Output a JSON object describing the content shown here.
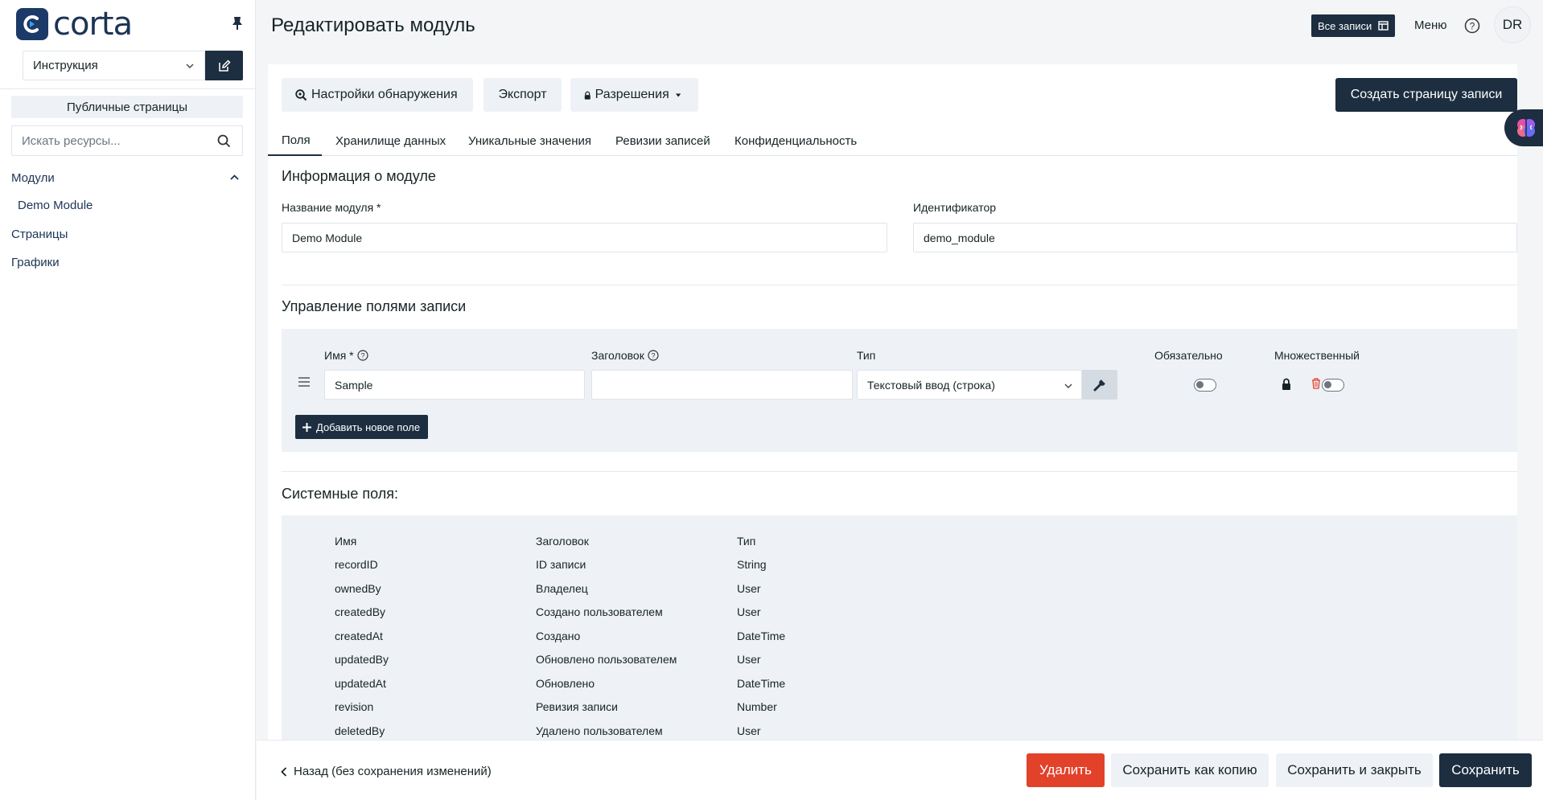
{
  "brand": {
    "name": "corta"
  },
  "sidebar": {
    "namespace": "Инструкция",
    "public_pages": "Публичные страницы",
    "search_placeholder": "Искать ресурсы...",
    "modules_heading": "Модули",
    "module_items": [
      "Demo Module"
    ],
    "pages": "Страницы",
    "charts": "Графики"
  },
  "header": {
    "title": "Редактировать модуль",
    "all_records": "Все записи",
    "menu": "Меню",
    "avatar_initials": "DR"
  },
  "toolbar": {
    "discovery": "Настройки обнаружения",
    "export": "Экспорт",
    "permissions": "Разрешения",
    "create_record_page": "Создать страницу записи"
  },
  "tabs": [
    {
      "label": "Поля",
      "active": true
    },
    {
      "label": "Хранилище данных",
      "active": false
    },
    {
      "label": "Уникальные значения",
      "active": false
    },
    {
      "label": "Ревизии записей",
      "active": false
    },
    {
      "label": "Конфиденциальность",
      "active": false
    }
  ],
  "module_info": {
    "title": "Информация о модуле",
    "name_label": "Название модуля *",
    "name_value": "Demo Module",
    "handle_label": "Идентификатор",
    "handle_value": "demo_module"
  },
  "record_fields": {
    "title": "Управление полями записи",
    "col_name": "Имя *",
    "col_label": "Заголовок",
    "col_type": "Тип",
    "col_required": "Обязательно",
    "col_multi": "Множественный",
    "rows": [
      {
        "name": "Sample",
        "label": "",
        "type": "Текстовый ввод (строка)",
        "required": false,
        "multi": false
      }
    ],
    "add_button": "Добавить новое поле"
  },
  "system_fields": {
    "title": "Системные поля:",
    "headers": [
      "Имя",
      "Заголовок",
      "Тип"
    ],
    "rows": [
      [
        "recordID",
        "ID записи",
        "String"
      ],
      [
        "ownedBy",
        "Владелец",
        "User"
      ],
      [
        "createdBy",
        "Создано пользователем",
        "User"
      ],
      [
        "createdAt",
        "Создано",
        "DateTime"
      ],
      [
        "updatedBy",
        "Обновлено пользователем",
        "User"
      ],
      [
        "updatedAt",
        "Обновлено",
        "DateTime"
      ],
      [
        "revision",
        "Ревизия записи",
        "Number"
      ],
      [
        "deletedBy",
        "Удалено пользователем",
        "User"
      ]
    ]
  },
  "footer": {
    "back": "Назад (без сохранения изменений)",
    "delete": "Удалить",
    "save_as_copy": "Сохранить как копию",
    "save_and_close": "Сохранить и закрыть",
    "save": "Сохранить"
  },
  "colors": {
    "primary": "#1c2e40",
    "danger": "#e2412a",
    "surface": "#eef1f5"
  }
}
